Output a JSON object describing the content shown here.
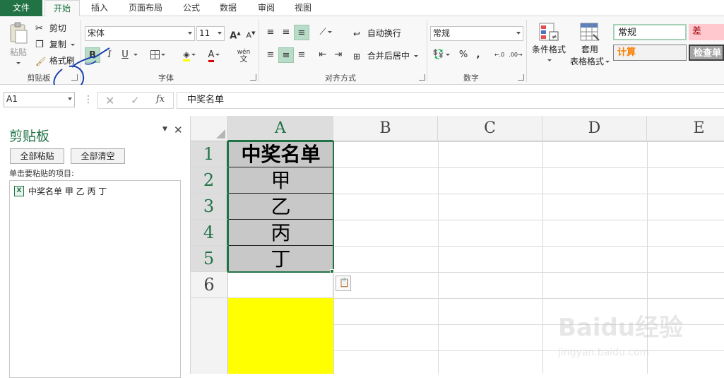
{
  "tabs": [
    "文件",
    "开始",
    "插入",
    "页面布局",
    "公式",
    "数据",
    "审阅",
    "视图"
  ],
  "ribbon": {
    "clipboard": {
      "paste": "粘贴",
      "cut": "剪切",
      "copy": "复制",
      "format_painter": "格式刷",
      "label": "剪贴板"
    },
    "font": {
      "name": "宋体",
      "size": "11",
      "bold": "B",
      "italic": "I",
      "underline": "U",
      "phonetic": "wén",
      "grow": "A",
      "shrink": "A",
      "color_letter": "A",
      "label": "字体"
    },
    "alignment": {
      "wrap": "自动换行",
      "merge": "合并后居中",
      "label": "对齐方式"
    },
    "number": {
      "format": "常规",
      "percent": "%",
      "comma": ",",
      "label": "数字"
    },
    "styles": {
      "conditional": "条件格式",
      "table_line1": "套用",
      "table_line2": "表格格式",
      "normal": "常规",
      "bad": "差",
      "calc": "计算",
      "check": "检查单"
    }
  },
  "formula_bar": {
    "name_box": "A1",
    "fx": "fx",
    "content": "中奖名单"
  },
  "clipboard_pane": {
    "title": "剪贴板",
    "paste_all": "全部粘贴",
    "clear_all": "全部清空",
    "instruction": "单击要粘贴的项目:",
    "items": [
      "中奖名单 甲 乙 丙 丁"
    ]
  },
  "grid": {
    "columns": [
      "A",
      "B",
      "C",
      "D",
      "E"
    ],
    "rows": [
      "1",
      "2",
      "3",
      "4",
      "5",
      "6"
    ],
    "cells_a": [
      "中奖名单",
      "甲",
      "乙",
      "丙",
      "丁"
    ]
  },
  "colors": {
    "brand": "#217346",
    "selection_fill": "#c8c8c8",
    "yellow_fill": "#ffff00",
    "annotation": "#1a3fb0",
    "style_normal": "#ffffff",
    "style_bad": "#ffc7ce",
    "style_calc": "#f2f2f2",
    "style_check": "#a5a5a5"
  },
  "watermark": "Baidu经验 jingyan.baidu.com"
}
